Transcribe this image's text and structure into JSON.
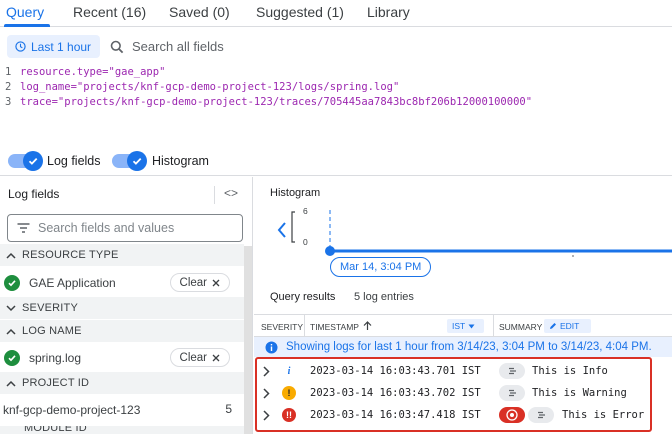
{
  "tabs": [
    {
      "label": "Query"
    },
    {
      "label": "Recent (16)"
    },
    {
      "label": "Saved (0)"
    },
    {
      "label": "Suggested (1)"
    },
    {
      "label": "Library"
    }
  ],
  "time_range": {
    "label": "Last 1 hour"
  },
  "search": {
    "placeholder": "Search all fields"
  },
  "editor": {
    "lines": [
      {
        "num": "1",
        "text": "resource.type=\"gae_app\""
      },
      {
        "num": "2",
        "text": "log_name=\"projects/knf-gcp-demo-project-123/logs/spring.log\""
      },
      {
        "num": "3",
        "text": "trace=\"projects/knf-gcp-demo-project-123/traces/705445aa7843bc8bf206b12000100000\""
      }
    ]
  },
  "toggles": {
    "log_fields": "Log fields",
    "histogram": "Histogram"
  },
  "log_fields_panel": {
    "title": "Log fields",
    "search_placeholder": "Search fields and values",
    "sections": {
      "resource_type": "RESOURCE TYPE",
      "severity": "SEVERITY",
      "log_name": "LOG NAME",
      "project_id": "PROJECT ID",
      "module_id": "MODULE ID"
    },
    "gae_application": "GAE Application",
    "spring_log": "spring.log",
    "project": {
      "name": "knf-gcp-demo-project-123",
      "count": "5"
    },
    "clear_label": "Clear"
  },
  "histogram": {
    "title": "Histogram",
    "y_max": "6",
    "y_min": "0",
    "time_chip": "Mar 14, 3:04 PM"
  },
  "results": {
    "title": "Query results",
    "count": "5 log entries",
    "columns": {
      "severity": "SEVERITY",
      "timestamp": "TIMESTAMP",
      "timezone": "IST",
      "summary": "SUMMARY",
      "edit": "EDIT"
    },
    "info": "Showing logs for last 1 hour from 3/14/23, 3:04 PM to 3/14/23, 4:04 PM.",
    "rows": [
      {
        "timestamp": "2023-03-14 16:03:43.701 IST",
        "summary": "This is Info",
        "severity": "info"
      },
      {
        "timestamp": "2023-03-14 16:03:43.702 IST",
        "summary": "This is Warning",
        "severity": "warning"
      },
      {
        "timestamp": "2023-03-14 16:03:47.418 IST",
        "summary": "This is Error",
        "severity": "error"
      }
    ]
  },
  "colors": {
    "accent": "#1a73e8",
    "error": "#d93025",
    "warning": "#f9ab00",
    "success": "#1e8e3e"
  }
}
